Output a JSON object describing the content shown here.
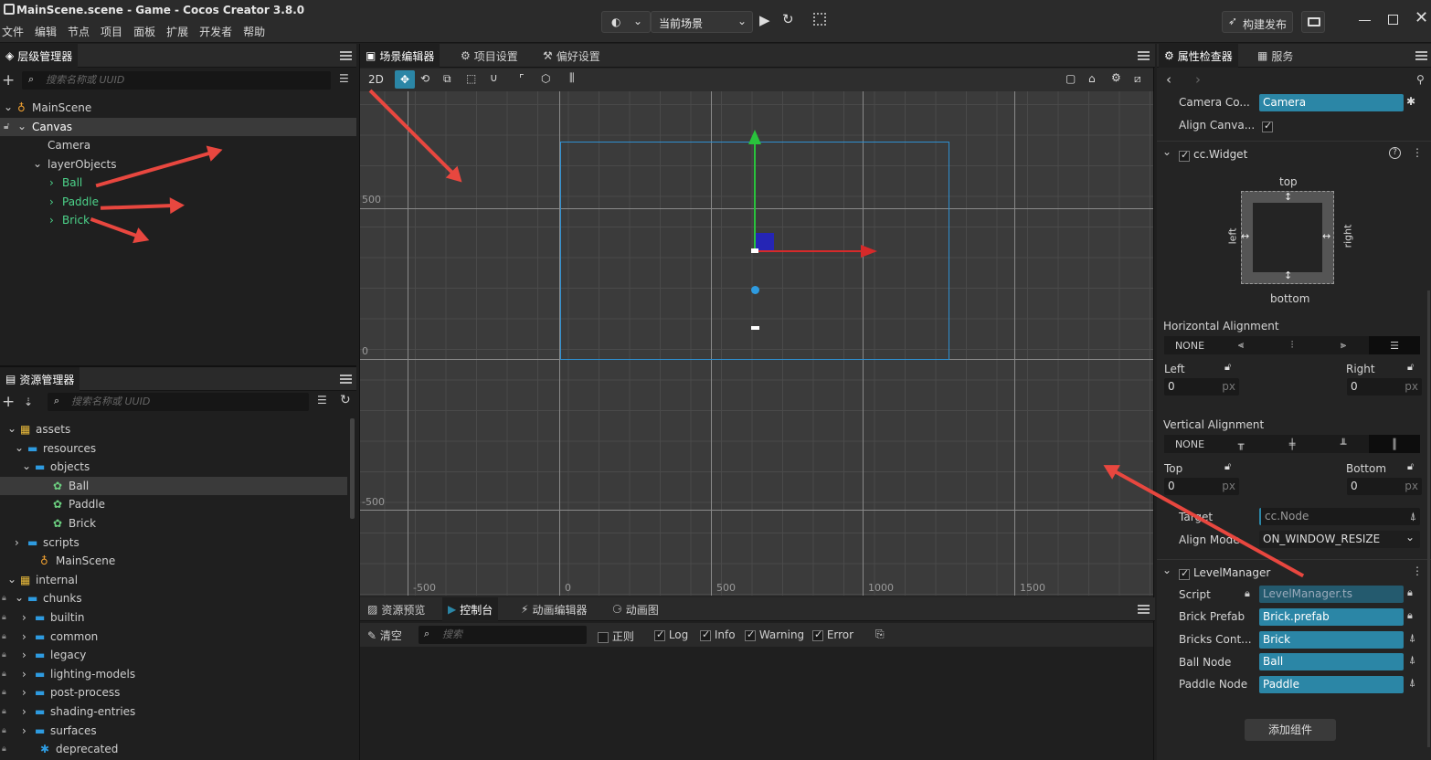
{
  "window": {
    "title": "MainScene.scene - Game - Cocos Creator 3.8.0"
  },
  "menu": [
    "文件",
    "编辑",
    "节点",
    "项目",
    "面板",
    "扩展",
    "开发者",
    "帮助"
  ],
  "toolbar": {
    "scene_select": "当前场景",
    "build_label": "构建发布"
  },
  "hierarchy": {
    "title": "层级管理器",
    "search_placeholder": "搜索名称或 UUID",
    "items": [
      {
        "label": "MainScene",
        "level": 0
      },
      {
        "label": "Canvas",
        "level": 1
      },
      {
        "label": "Camera",
        "level": 2
      },
      {
        "label": "layerObjects",
        "level": 2
      },
      {
        "label": "Ball",
        "level": 3
      },
      {
        "label": "Paddle",
        "level": 3
      },
      {
        "label": "Brick",
        "level": 3
      }
    ]
  },
  "assets": {
    "title": "资源管理器",
    "search_placeholder": "搜索名称或 UUID",
    "items": [
      {
        "label": "assets"
      },
      {
        "label": "resources"
      },
      {
        "label": "objects"
      },
      {
        "label": "Ball"
      },
      {
        "label": "Paddle"
      },
      {
        "label": "Brick"
      },
      {
        "label": "scripts"
      },
      {
        "label": "MainScene"
      },
      {
        "label": "internal"
      },
      {
        "label": "chunks"
      },
      {
        "label": "builtin"
      },
      {
        "label": "common"
      },
      {
        "label": "legacy"
      },
      {
        "label": "lighting-models"
      },
      {
        "label": "post-process"
      },
      {
        "label": "shading-entries"
      },
      {
        "label": "surfaces"
      },
      {
        "label": "deprecated"
      }
    ]
  },
  "scene": {
    "tabs": [
      "场景编辑器",
      "项目设置",
      "偏好设置"
    ],
    "mode_2d": "2D",
    "axis_labels": {
      "y500": "500",
      "y0": "0",
      "yneg500": "-500",
      "xneg500": "-500",
      "x0": "0",
      "x500": "500",
      "x1000": "1000",
      "x1500": "1500"
    }
  },
  "console": {
    "tabs": [
      "资源预览",
      "控制台",
      "动画编辑器",
      "动画图"
    ],
    "clear_label": "清空",
    "search_placeholder": "搜索",
    "filters": {
      "regex": "正则",
      "log": "Log",
      "info": "Info",
      "warning": "Warning",
      "error": "Error"
    }
  },
  "inspector": {
    "tabs": [
      "属性检查器",
      "服务"
    ],
    "camera_component": {
      "label": "Camera Co...",
      "value": "Camera"
    },
    "align_canvas": {
      "label": "Align Canva..."
    },
    "widget": {
      "title": "cc.Widget",
      "top": "top",
      "bottom": "bottom",
      "left": "left",
      "right": "right",
      "h_align_label": "Horizontal Alignment",
      "v_align_label": "Vertical Alignment",
      "none": "NONE",
      "left_label": "Left",
      "right_label": "Right",
      "top_label": "Top",
      "bottom_label": "Bottom",
      "left_value": "0",
      "right_value": "0",
      "top_value": "0",
      "bottom_value": "0",
      "unit": "px",
      "target_label": "Target",
      "target_value": "cc.Node",
      "align_mode_label": "Align Mode",
      "align_mode_value": "ON_WINDOW_RESIZE"
    },
    "level_manager": {
      "title": "LevelManager",
      "props": [
        {
          "label": "Script",
          "value": "LevelManager.ts"
        },
        {
          "label": "Brick Prefab",
          "value": "Brick.prefab"
        },
        {
          "label": "Bricks Cont...",
          "value": "Brick"
        },
        {
          "label": "Ball Node",
          "value": "Ball"
        },
        {
          "label": "Paddle Node",
          "value": "Paddle"
        }
      ]
    },
    "add_component": "添加组件"
  },
  "colors": {
    "accent": "#2b86a6",
    "annotation": "#e8473f"
  }
}
